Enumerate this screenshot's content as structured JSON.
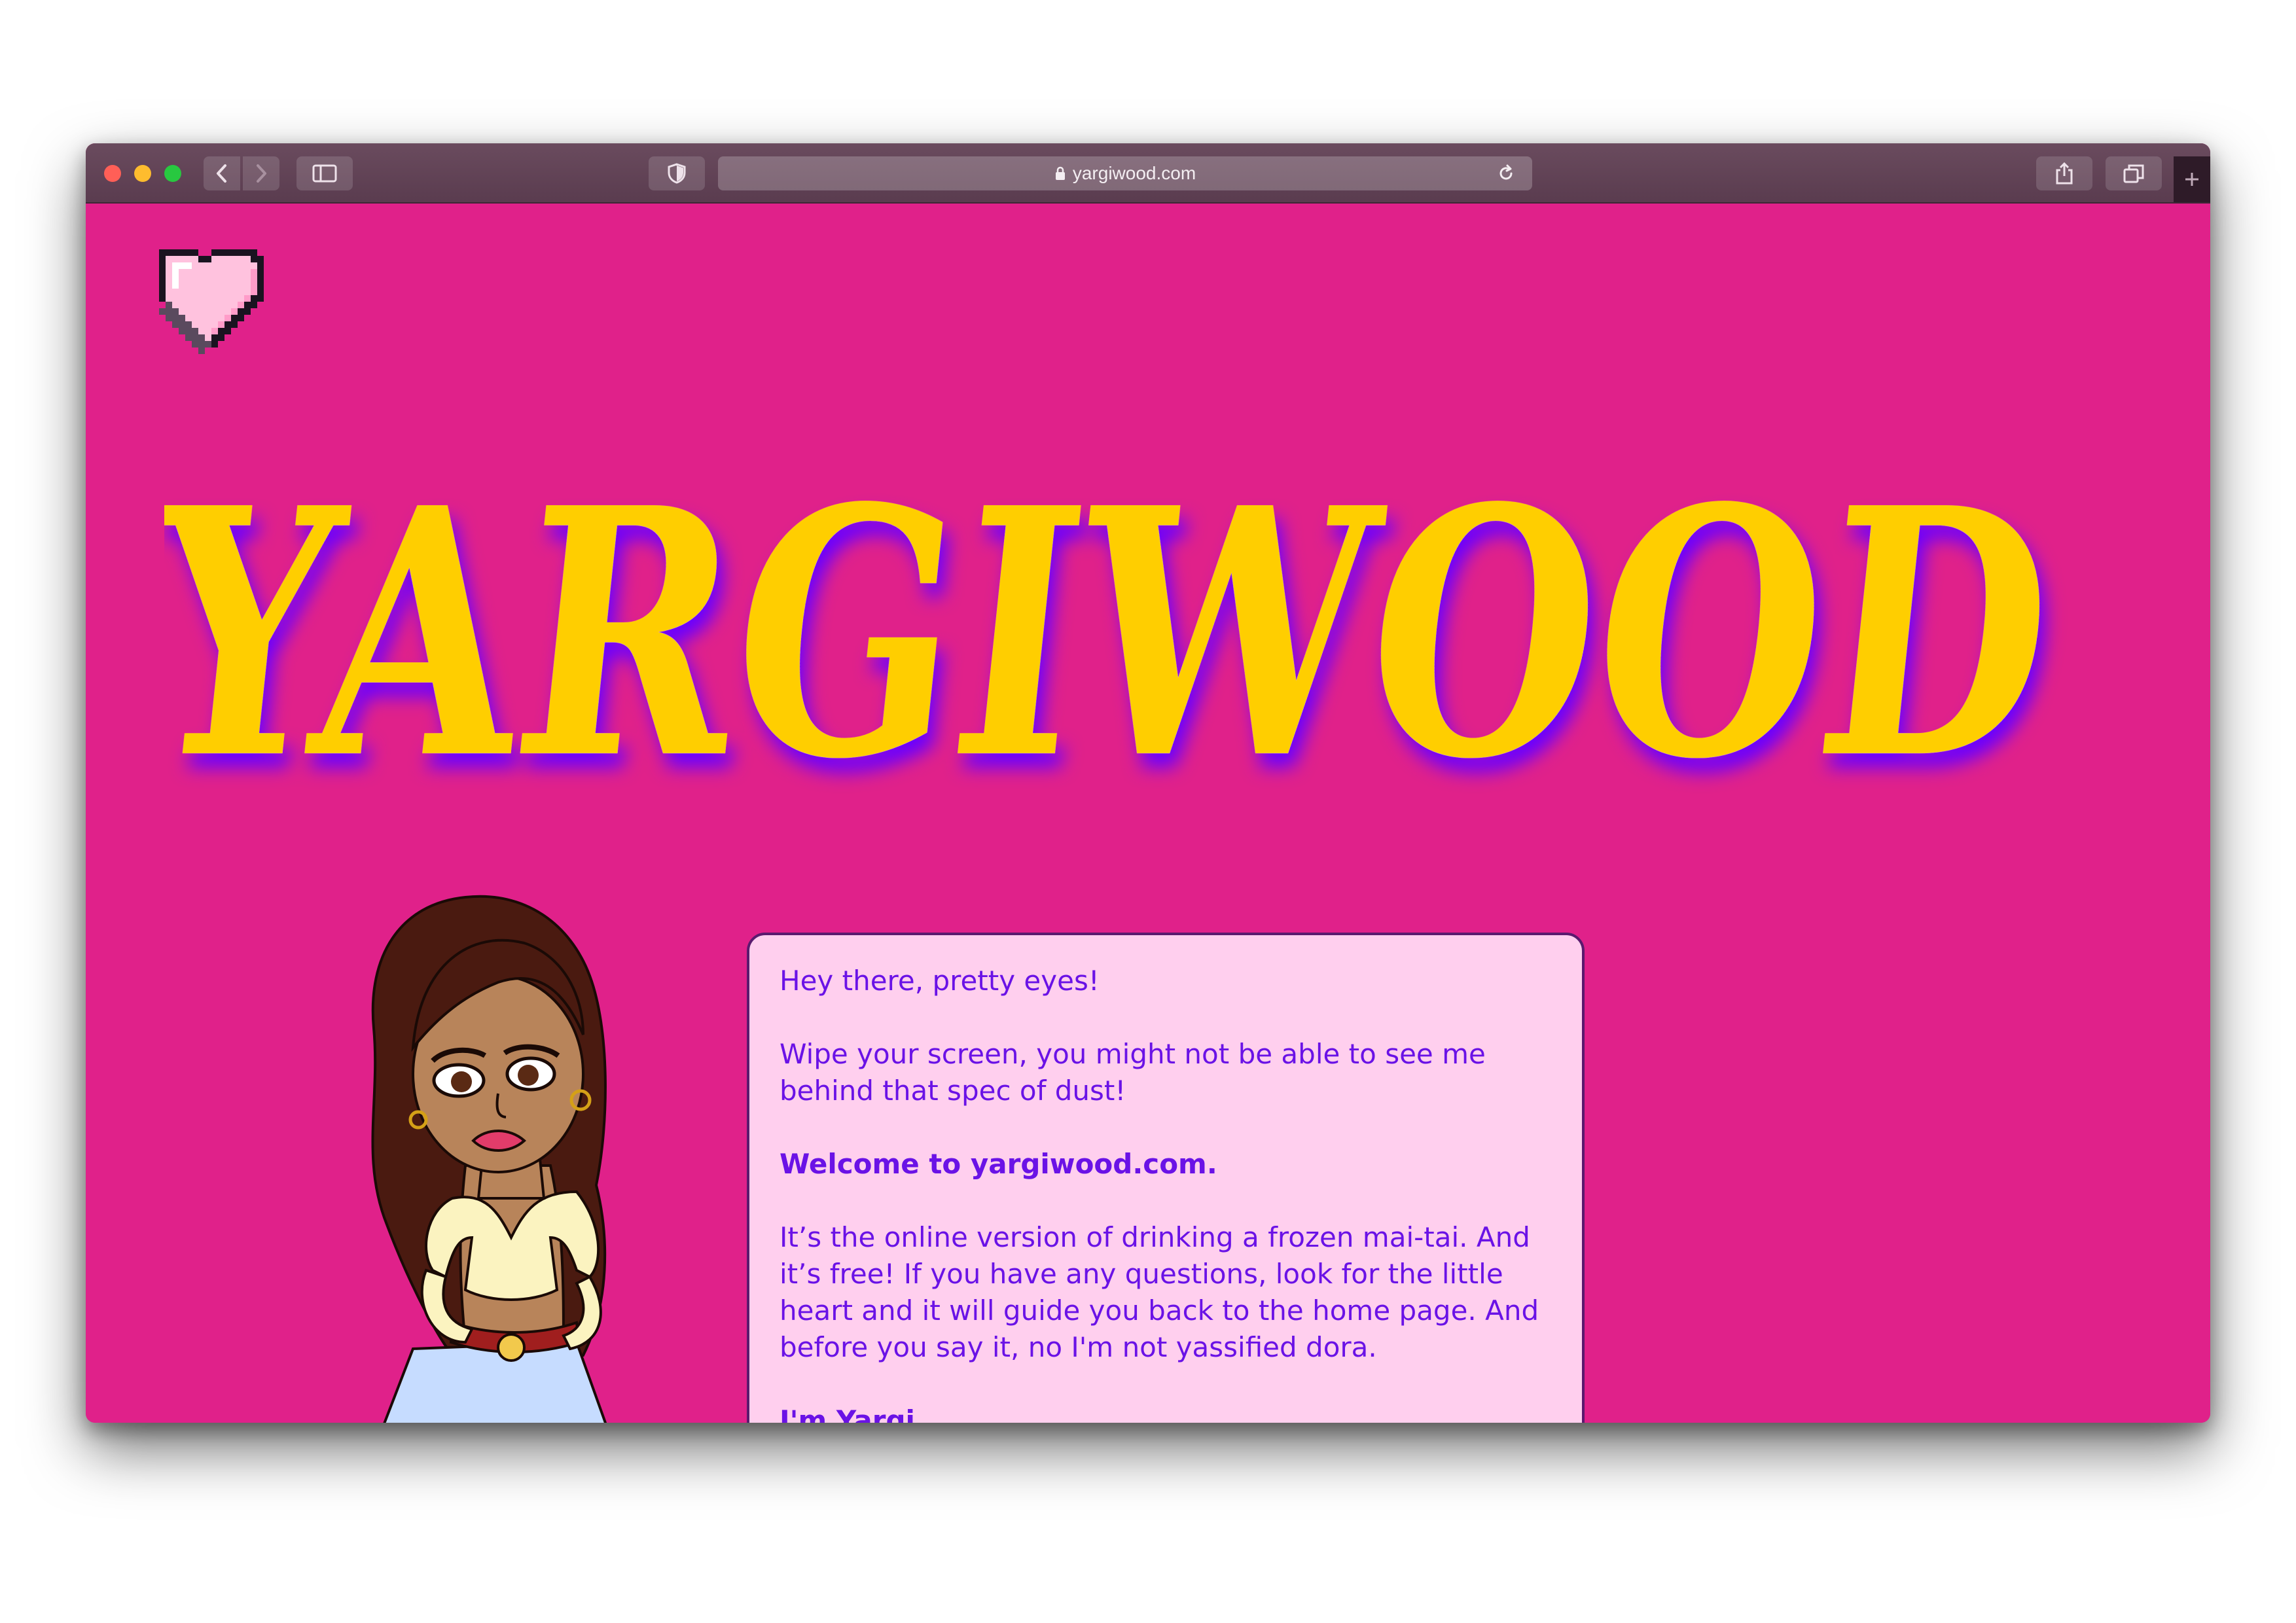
{
  "browser": {
    "url": "yargiwood.com",
    "colors": {
      "toolbar": "#5a3c4f",
      "close": "#ff5f57",
      "minimize": "#febc2e",
      "zoom": "#28c840"
    }
  },
  "page": {
    "background_color": "#e0218a",
    "home_icon": "pixel-heart-icon",
    "logo_text": "YARGIWOOD",
    "logo_color": "#ffce00",
    "logo_shadow_color": "#6a00ff",
    "avatar": "cartoon-girl-avatar"
  },
  "intro": {
    "greeting": "Hey there, pretty eyes!",
    "wipe_line": "Wipe your screen, you might not be able to see me behind that spec of dust!",
    "welcome": "Welcome to yargiwood.com.",
    "description": "It’s the online version of drinking a frozen mai-tai. And it’s free! If you have any questions, look for the little heart and it will guide you back to the home page. And before you say it, no I'm not yassified dora.",
    "signoff": "I'm Yargi.",
    "bubble_color": "#ffcfee",
    "text_color": "#6a12e6"
  }
}
